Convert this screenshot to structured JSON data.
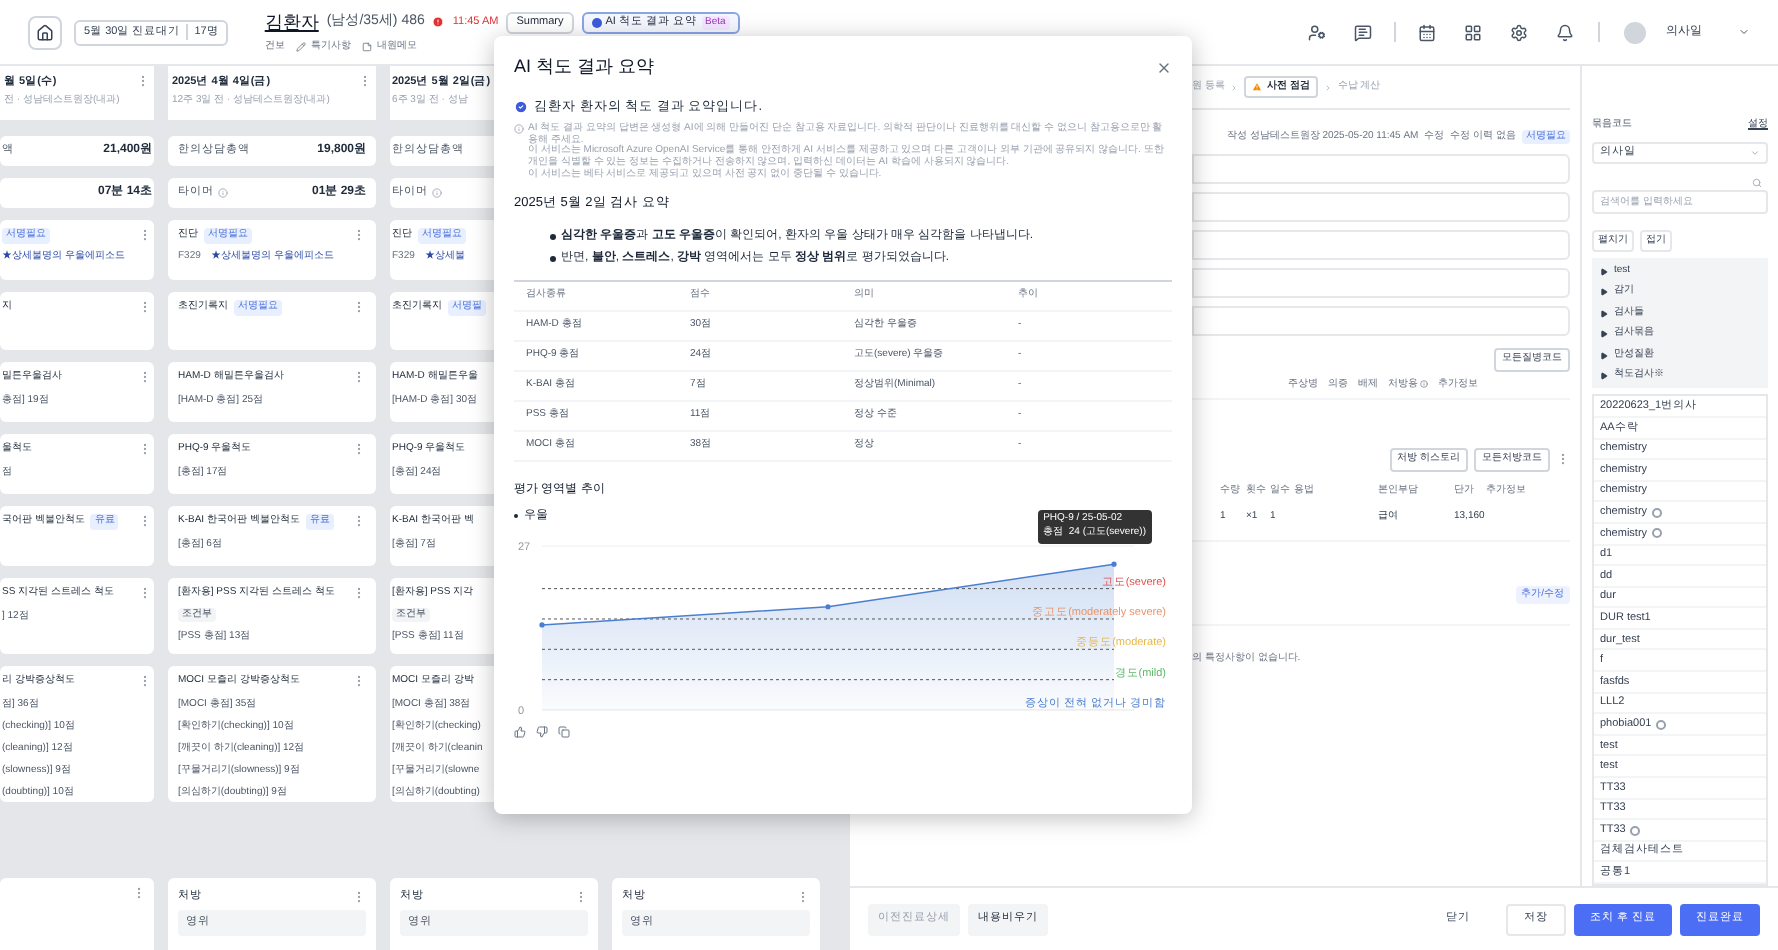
{
  "top_bar": {
    "waiting_label": "5월 30일 진료대기",
    "waiting_count": "17명",
    "patient": {
      "name": "김환자",
      "info": "(남성/35세) 486",
      "insurance": "건보"
    },
    "time": "11:45 AM",
    "buttons": [
      {
        "label": "Summary",
        "selected": false
      },
      {
        "label": "AI 척도 결과 요약",
        "badge": "Beta",
        "selected": true
      }
    ],
    "links": [
      "특기사항",
      "내원메모"
    ],
    "user": "의사일"
  },
  "timeline": {
    "columns": [
      {
        "date": "월 5일(수)",
        "subtitle": "전 · 성남테스트원장(내과)",
        "cards": [
          {
            "kind": "amount",
            "label": "액",
            "value": "21,400원"
          },
          {
            "kind": "amount",
            "value": "07분 14초"
          },
          {
            "kind": "note",
            "badge": "서명필요",
            "text": "★상세불명의 우울에피소드"
          },
          {
            "kind": "note",
            "title": "지"
          },
          {
            "kind": "note",
            "title": "밀튼우울검사",
            "lines": [
              "총점] 19점"
            ]
          },
          {
            "kind": "note",
            "title": "울척도",
            "lines": [
              "점"
            ]
          },
          {
            "kind": "note",
            "title": "국어판 벡불안척도",
            "badge": "유료"
          },
          {
            "kind": "note",
            "title": "SS 지각된 스트레스 척도",
            "lines": [
              "] 12점"
            ]
          },
          {
            "kind": "note",
            "title": "리 강박증상척도",
            "lines": [
              "점] 36점",
              "(checking)] 10점",
              "(cleaning)] 12점",
              "(slowness)] 9점",
              "(doubting)] 10점"
            ]
          }
        ],
        "bottom": {
          "kind": "empty"
        }
      },
      {
        "date": "2025년 4월 4일(금)",
        "subtitle": "12주 3일 전 · 성남테스트원장(내과)",
        "cards": [
          {
            "kind": "amount",
            "label": "한의상담총액",
            "value": "19,800원"
          },
          {
            "kind": "timer",
            "label": "타이머",
            "value": "01분 29초"
          },
          {
            "kind": "note",
            "title": "진단",
            "badge": "서명필요",
            "code": "F329",
            "text": "★상세불명의 우울에피소드"
          },
          {
            "kind": "note",
            "title": "초진기록지",
            "badge": "서명필요"
          },
          {
            "kind": "note",
            "title": "HAM-D 해밀튼우울검사",
            "lines": [
              "[HAM-D 총점] 25점"
            ]
          },
          {
            "kind": "note",
            "title": "PHQ-9 우울척도",
            "lines": [
              "[총점] 17점"
            ]
          },
          {
            "kind": "note",
            "title": "K-BAI 한국어판 벡불안척도",
            "badge": "유료",
            "lines": [
              "[총점] 6점"
            ]
          },
          {
            "kind": "note",
            "title": "[환자용] PSS 지각된 스트레스 척도",
            "tag": "조건부",
            "lines": [
              "[PSS 총점] 13점"
            ]
          },
          {
            "kind": "note",
            "title": "MOCI 모즐리 강박증상척도",
            "lines": [
              "[MOCI 총점] 35점",
              "[확인하기(checking)] 10점",
              "[깨끗이 하기(cleaning)] 12점",
              "[꾸물거리기(slowness)] 9점",
              "[의심하기(doubting)] 9점"
            ]
          }
        ],
        "bottom": {
          "kind": "prescription",
          "title": "처방",
          "row": "영위"
        }
      },
      {
        "date": "2025년 5월 2일(금)",
        "subtitle": "6주 3일 전 · 성남",
        "cards": [
          {
            "kind": "amount",
            "label": "한의상담총액"
          },
          {
            "kind": "timer",
            "label": "타이머"
          },
          {
            "kind": "note",
            "title": "진단",
            "badge": "서명필요",
            "code": "F329",
            "text": "★상세불"
          },
          {
            "kind": "note",
            "title": "초진기록지",
            "badge": "서명필"
          },
          {
            "kind": "note",
            "title": "HAM-D 해밀튼우울",
            "lines": [
              "[HAM-D 총점] 30점"
            ]
          },
          {
            "kind": "note",
            "title": "PHQ-9 우울척도",
            "lines": [
              "[총점] 24점"
            ]
          },
          {
            "kind": "note",
            "title": "K-BAI 한국어판 벡",
            "lines": [
              "[총점] 7점"
            ]
          },
          {
            "kind": "note",
            "title": "[환자용] PSS 지각",
            "tag": "조건부",
            "lines": [
              "[PSS 총점] 11점"
            ]
          },
          {
            "kind": "note",
            "title": "MOCI 모즐리 강박",
            "lines": [
              "[MOCI 총점] 38점",
              "[확인하기(checking)",
              "[깨끗이 하기(cleanin",
              "[꾸물거리기(slowne",
              "[의심하기(doubting)"
            ]
          }
        ],
        "bottom": {
          "kind": "prescription",
          "title": "처방",
          "row": "영위"
        }
      },
      {
        "bottom": {
          "kind": "prescription",
          "title": "처방",
          "row": "영위"
        }
      }
    ]
  },
  "encounter": {
    "breadcrumb": [
      {
        "label": "원 등록",
        "selected": false
      },
      {
        "label": "사전 점검",
        "selected": true
      },
      {
        "label": "수납 계산",
        "selected": false
      }
    ],
    "author": "작성 성남테스트원장 2025-05-20 11:45 AM",
    "edit": "수정",
    "edit_history": "수정 이력 없음",
    "sign_badge": "서명필요",
    "diagnosis_button": "모든질병코드",
    "diagnosis_tabs": [
      "주상병",
      "의증",
      "배제",
      "처방용",
      "추가정보"
    ],
    "prescription_buttons": [
      "처방 히스토리",
      "모든처방코드"
    ],
    "prescription_table": {
      "columns": [
        "수량",
        "횟수",
        "일수",
        "용법",
        "본인부담",
        "단가",
        "추가정보"
      ],
      "rows": [
        {
          "qty": "1",
          "times": "×1",
          "days": "1",
          "copay": "급여",
          "price": "13,160"
        }
      ]
    },
    "edit_link": "추가/수정",
    "note": "의 특정사항이 없습니다.",
    "footer": {
      "left_buttons": [
        {
          "label": "이전진료상세",
          "disabled": true
        },
        {
          "label": "내용비우기",
          "disabled": false
        }
      ],
      "right_buttons": [
        {
          "label": "닫기",
          "kind": "text"
        },
        {
          "label": "저장",
          "kind": "outline"
        },
        {
          "label": "조치 후 진료",
          "kind": "primary"
        },
        {
          "label": "진료완료",
          "kind": "primary"
        }
      ]
    }
  },
  "bundle_sidebar": {
    "title": "묶음코드",
    "setting": "설정",
    "select": "의사일",
    "search_placeholder": "검색어를 입력하세요",
    "expand": "펼치기",
    "collapse": "접기",
    "folders": [
      "test",
      "감기",
      "검사들",
      "검사묶음",
      "만성질환",
      "척도검사※"
    ],
    "items": [
      {
        "label": "20220623_1번의사",
        "linked": false
      },
      {
        "label": "AA수락",
        "linked": false
      },
      {
        "label": "chemistry",
        "linked": false
      },
      {
        "label": "chemistry",
        "linked": false
      },
      {
        "label": "chemistry",
        "linked": false
      },
      {
        "label": "chemistry",
        "linked": true
      },
      {
        "label": "chemistry",
        "linked": true
      },
      {
        "label": "d1",
        "linked": false
      },
      {
        "label": "dd",
        "linked": false
      },
      {
        "label": "dur",
        "linked": false
      },
      {
        "label": "DUR test1",
        "linked": false
      },
      {
        "label": "dur_test",
        "linked": false
      },
      {
        "label": "f",
        "linked": false
      },
      {
        "label": "fasfds",
        "linked": false
      },
      {
        "label": "LLL2",
        "linked": false
      },
      {
        "label": "phobia001",
        "linked": true
      },
      {
        "label": "test",
        "linked": false
      },
      {
        "label": "test",
        "linked": false
      },
      {
        "label": "TT33",
        "linked": false
      },
      {
        "label": "TT33",
        "linked": false
      },
      {
        "label": "TT33",
        "linked": true
      },
      {
        "label": "검체검사테스트",
        "linked": false
      },
      {
        "label": "공통1",
        "linked": false
      }
    ]
  },
  "modal": {
    "title": "AI 척도 결과 요약",
    "intro": "김환자 환자의 척도 결과 요약입니다.",
    "notice": [
      "AI 척도 결과 요약의 답변은 생성형 AI에 의해 만들어진 단순 참고용 자료입니다. 의학적 판단이나 진료행위를 대신할 수 없으니 참고용으로만 활용해 주세요.",
      "이 서비스는 Microsoft Azure OpenAI Service를 통해 안전하게 AI 서비스를 제공하고 있으며 다른 고객이나 외부 기관에 공유되지 않습니다. 또한 개인을 식별할 수 있는 정보는 수집하거나 전송하지 않으며, 입력하신 데이터는 AI 학습에 사용되지 않습니다.",
      "이 서비스는 베타 서비스로 제공되고 있으며 사전 공지 없이 중단될 수 있습니다."
    ],
    "section_title": "2025년 5월 2일 검사 요약",
    "bullets": [
      "**심각한 우울증**과 **고도 우울증**이 확인되어, 환자의 우울 상태가 매우 심각함을 나타냅니다.",
      "반면, **불안**, **스트레스**, **강박** 영역에서는 모두 **정상 범위**로 평가되었습니다."
    ],
    "table": {
      "columns": [
        "검사종류",
        "점수",
        "의미",
        "추이"
      ],
      "rows": [
        [
          "HAM-D 총점",
          "30점",
          "심각한 우울증",
          "-"
        ],
        [
          "PHQ-9 총점",
          "24점",
          "고도(severe) 우울증",
          "-"
        ],
        [
          "K-BAI 총점",
          "7점",
          "정상범위(Minimal)",
          "-"
        ],
        [
          "PSS 총점",
          "11점",
          "정상 수준",
          "-"
        ],
        [
          "MOCI 총점",
          "38점",
          "정상",
          "-"
        ]
      ]
    },
    "trend_title": "평가 영역별 추이",
    "chart_title": "우울",
    "chart_data": {
      "type": "area",
      "series": [
        {
          "color": "#4a7fd0",
          "values": [
            14,
            17,
            24
          ]
        }
      ],
      "ylim": [
        0,
        27
      ],
      "yticks": [
        0,
        27
      ],
      "ref_lines": [
        {
          "label": "고도(severe)",
          "color": "#e05252"
        },
        {
          "label": "중고도(moderately severe)",
          "color": "#e8956b"
        },
        {
          "label": "중등도(moderate)",
          "color": "#e6b84a"
        },
        {
          "label": "경도(mild)",
          "color": "#5fb86a"
        },
        {
          "label": "증상이 전혀 없거나 경미함",
          "color": "#4a7fd0"
        }
      ]
    },
    "tooltip": {
      "title": "PHQ-9 / 25-05-02",
      "label": "총점",
      "value": "24 (고도(severe))"
    }
  }
}
